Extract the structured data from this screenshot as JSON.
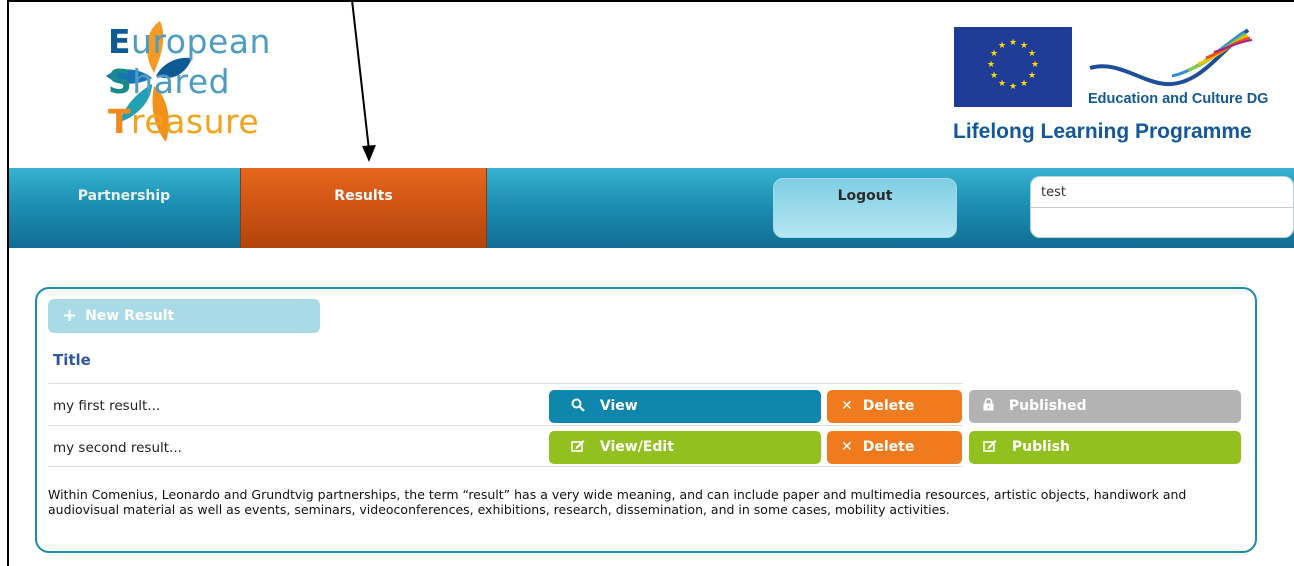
{
  "brand": {
    "logo_lines": [
      {
        "cap": "E",
        "rest": "uropean"
      },
      {
        "cap": "S",
        "rest": "hared"
      },
      {
        "cap": "T",
        "rest": "reasure"
      }
    ],
    "partner_label": "Education and Culture DG",
    "programme_label": "Lifelong Learning Programme"
  },
  "nav": {
    "partnership_label": "Partnership",
    "results_label": "Results",
    "logout_label": "Logout",
    "user_value": "test"
  },
  "results": {
    "new_result_label": "New Result",
    "title_header": "Title",
    "rows": [
      {
        "title": "my first result...",
        "primary_label": "View",
        "delete_label": "Delete",
        "status_label": "Published"
      },
      {
        "title": "my second result...",
        "primary_label": "View/Edit",
        "delete_label": "Delete",
        "status_label": "Publish"
      }
    ],
    "description": "Within Comenius, Leonardo and Grundtvig partnerships, the term “result” has a very wide meaning, and can include paper and multimedia resources, artistic objects, handiwork and audiovisual material as well as events, seminars, videoconferences, exhibitions, research, dissemination, and in some cases, mobility activities."
  },
  "icons": {
    "new_result": "plus-icon",
    "view": "search-icon",
    "edit": "edit-icon",
    "delete": "close-icon",
    "published": "lock-icon",
    "publish": "edit-icon"
  },
  "colors": {
    "nav_blue": "#1d8fb3",
    "nav_active_orange": "#d4581a",
    "button_blue": "#0f87ad",
    "button_orange": "#ef7b1e",
    "button_gray": "#b3b3b3",
    "button_green": "#92c01f",
    "title_blue": "#2f57a6"
  }
}
